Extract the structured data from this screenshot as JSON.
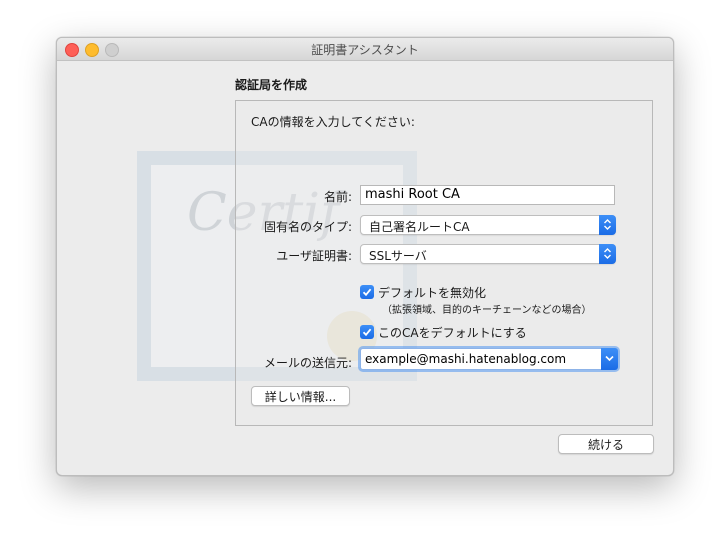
{
  "window": {
    "title": "証明書アシスタント"
  },
  "watermark": {
    "script_text": "Certif"
  },
  "section": {
    "title": "認証局を作成",
    "instruction": "CAの情報を入力してください:"
  },
  "form": {
    "name_label": "名前:",
    "name_value": "mashi Root CA",
    "identity_type_label": "固有名のタイプ:",
    "identity_type_value": "自己署名ルートCA",
    "user_cert_label": "ユーザ証明書:",
    "user_cert_value": "SSLサーバ",
    "override_defaults_label": "デフォルトを無効化",
    "override_defaults_sub": "（拡張領域、目的のキーチェーンなどの場合）",
    "override_defaults_checked": true,
    "make_default_label": "このCAをデフォルトにする",
    "make_default_checked": true,
    "email_from_label": "メールの送信元:",
    "email_from_value": "example@mashi.hatenablog.com"
  },
  "buttons": {
    "learn_more": "詳しい情報...",
    "continue": "続ける"
  },
  "colors": {
    "accent": "#1b6ce6",
    "close": "#fe5f57",
    "minimize": "#febc2e",
    "zoom_disabled": "#cfcfcf"
  }
}
